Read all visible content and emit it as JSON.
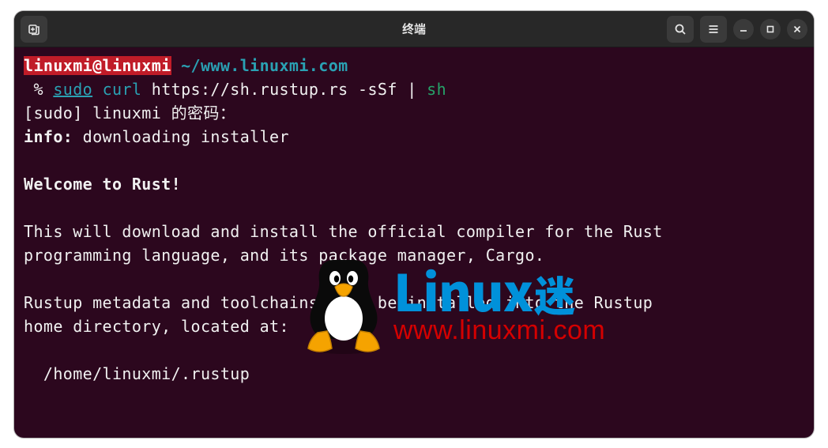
{
  "window": {
    "title": "终端"
  },
  "terminal": {
    "prompt_user": "linuxmi@linuxmi",
    "prompt_path": "~/www.linuxmi.com",
    "prompt_symbol": " %",
    "cmd_sudo": "sudo",
    "cmd_curl": "curl",
    "cmd_url": "https://sh.rustup.rs -sSf",
    "cmd_pipe": "|",
    "cmd_sh": "sh",
    "sudo_prompt": "[sudo] linuxmi 的密码：",
    "info_prefix": "info:",
    "info_text": " downloading installer",
    "welcome": "Welcome to Rust!",
    "para1_l1": "This will download and install the official compiler for the Rust",
    "para1_l2": "programming language, and its package manager, Cargo.",
    "para2_l1": "Rustup metadata and toolchains will be installed into the Rustup",
    "para2_l2": "home directory, located at:",
    "path": "  /home/linuxmi/.rustup"
  },
  "watermark": {
    "brand_en": "Linux",
    "brand_cn": "迷",
    "url": "www.linuxmi.com"
  },
  "icons": {
    "newtab": "new-tab-icon",
    "search": "search-icon",
    "menu": "hamburger-icon",
    "minimize": "minimize-icon",
    "maximize": "maximize-icon",
    "close": "close-icon"
  }
}
